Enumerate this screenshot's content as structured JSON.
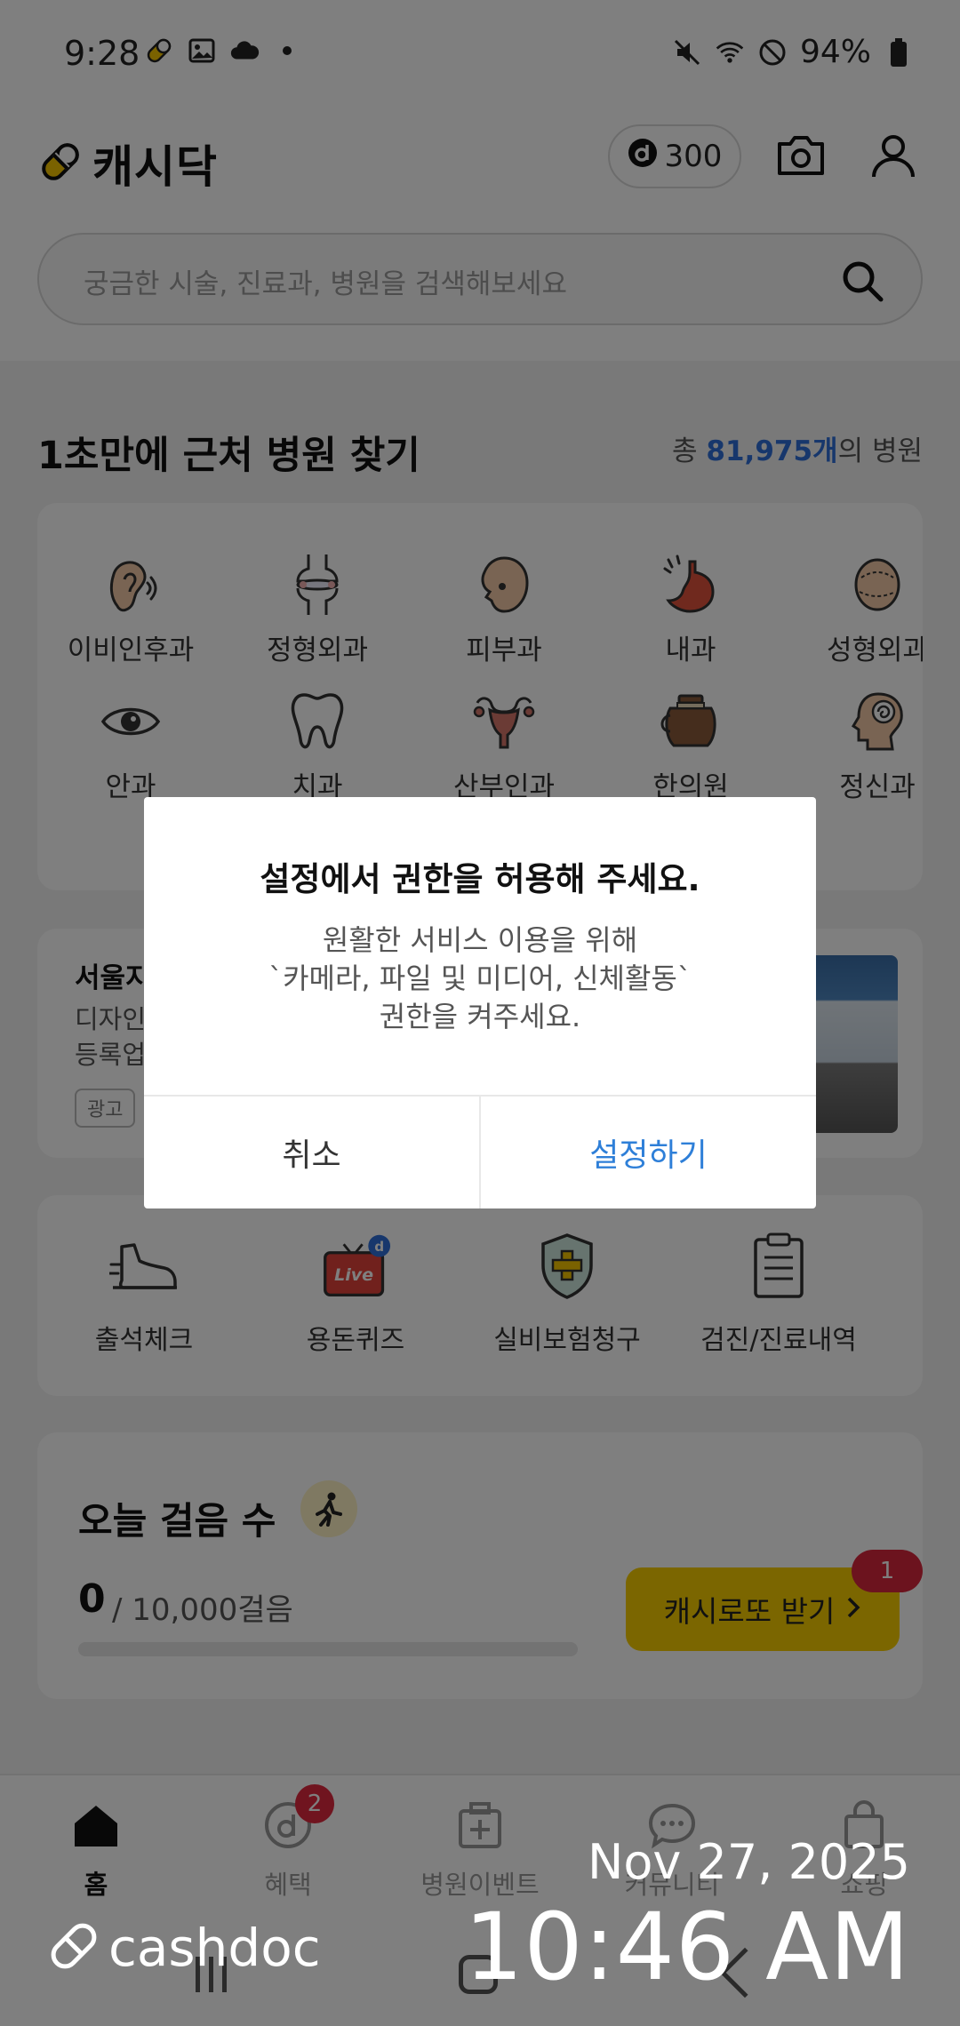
{
  "status_bar": {
    "time": "9:28",
    "battery": "94%"
  },
  "header": {
    "app_name": "캐시닥",
    "points": "300"
  },
  "search": {
    "placeholder": "궁금한 시술, 진료과, 병원을 검색해보세요"
  },
  "nearby": {
    "title": "1초만에 근처 병원 찾기",
    "count_prefix": "총 ",
    "count_value": "81,975개",
    "count_suffix": "의 병원"
  },
  "categories": [
    {
      "label": "이비인후과",
      "icon": "ear-icon"
    },
    {
      "label": "정형외과",
      "icon": "bone-icon"
    },
    {
      "label": "피부과",
      "icon": "face-icon"
    },
    {
      "label": "내과",
      "icon": "stomach-icon"
    },
    {
      "label": "성형외과",
      "icon": "head-icon"
    },
    {
      "label": "안과",
      "icon": "eye-icon"
    },
    {
      "label": "치과",
      "icon": "tooth-icon"
    },
    {
      "label": "산부인과",
      "icon": "uterus-icon"
    },
    {
      "label": "한의원",
      "icon": "herb-pot-icon"
    },
    {
      "label": "정신과",
      "icon": "mind-icon"
    }
  ],
  "ad": {
    "title": "서울지",
    "desc_line1": "디자인",
    "desc_line2": "등록업",
    "tag": "광고"
  },
  "quick_menu": [
    {
      "label": "출석체크",
      "icon": "sneaker-icon"
    },
    {
      "label": "용돈퀴즈",
      "icon": "live-tv-icon"
    },
    {
      "label": "실비보험청구",
      "icon": "shield-plus-icon"
    },
    {
      "label": "검진/진료내역",
      "icon": "clipboard-icon"
    }
  ],
  "steps": {
    "title": "오늘 걸음 수",
    "count": "0",
    "goal": "/ 10,000걸음",
    "progress": 0,
    "lotto_label": "캐시로또 받기",
    "lotto_badge": "1"
  },
  "bottom_nav": [
    {
      "label": "홈",
      "icon": "home-icon",
      "active": true
    },
    {
      "label": "혜택",
      "icon": "benefit-icon",
      "badge": "2"
    },
    {
      "label": "병원이벤트",
      "icon": "medkit-icon"
    },
    {
      "label": "커뮤니티",
      "icon": "chat-icon"
    },
    {
      "label": "쇼핑",
      "icon": "bag-icon"
    }
  ],
  "dialog": {
    "title": "설정에서 권한을 허용해 주세요.",
    "body_line1": "원활한 서비스 이용을 위해",
    "body_line2": "`카메라, 파일 및 미디어, 신체활동`",
    "body_line3": "권한을 켜주세요.",
    "cancel_label": "취소",
    "confirm_label": "설정하기"
  },
  "watermark": {
    "brand": "cashdoc",
    "date": "Nov 27, 2025",
    "time": "10:46 AM"
  },
  "colors": {
    "accent_blue": "#2e7fd8",
    "brand_yellow": "#f7cd00",
    "badge_red": "#d9263c"
  }
}
